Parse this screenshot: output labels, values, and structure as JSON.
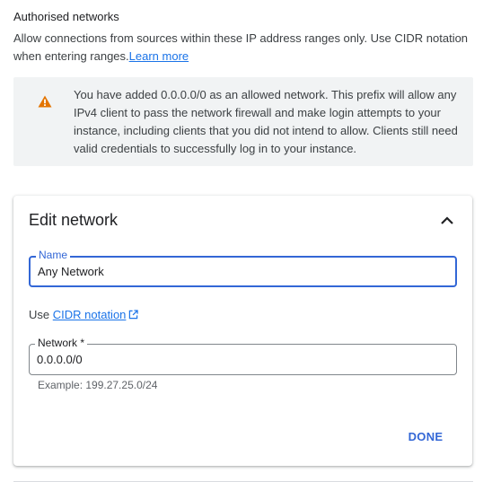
{
  "section": {
    "title": "Authorised networks",
    "description": "Allow connections from sources within these IP address ranges only. Use CIDR notation when entering ranges.",
    "learn_more": "Learn more"
  },
  "warning": {
    "icon": "warning-triangle-icon",
    "text": "You have added 0.0.0.0/0 as an allowed network. This prefix will allow any IPv4 client to pass the network firewall and make login attempts to your instance, including clients that you did not intend to allow. Clients still need valid credentials to successfully log in to your instance."
  },
  "edit_network": {
    "title": "Edit network",
    "collapse_icon": "chevron-up-icon",
    "name_field": {
      "label": "Name",
      "value": "Any Network"
    },
    "cidr_hint": {
      "prefix": "Use",
      "link": "CIDR notation",
      "icon": "external-link-icon"
    },
    "network_field": {
      "label": "Network *",
      "value": "0.0.0.0/0",
      "helper": "Example: 199.27.25.0/24"
    },
    "done_label": "DONE"
  },
  "colors": {
    "accent": "#3367d6",
    "link": "#1a73e8",
    "warning": "#e37400",
    "warning_bg": "#f1f3f4"
  }
}
